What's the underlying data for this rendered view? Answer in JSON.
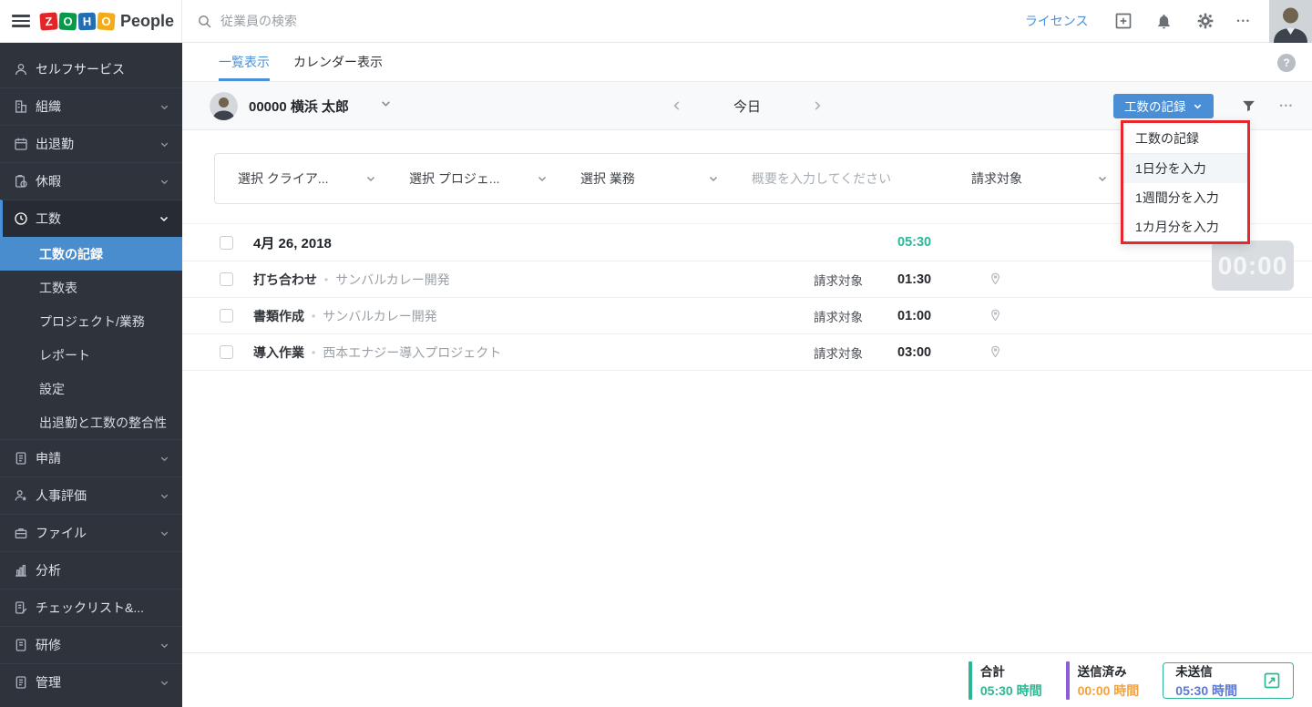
{
  "colors": {
    "accent_blue": "#4a90d9",
    "sidebar_bg": "#2e333c",
    "active_subitem_bg": "#4a8dce",
    "total_green": "#26b99a",
    "submitted_purple": "#8e5bd9",
    "submitted_orange": "#f0a340",
    "unsubmitted_blue": "#5b79d4",
    "annotation_red": "#e8272c"
  },
  "icons": {
    "ellipsis": "•••"
  },
  "header": {
    "logo_letters": [
      "Z",
      "O",
      "H",
      "O"
    ],
    "product": "People",
    "search_placeholder": "従業員の検索",
    "license": "ライセンス"
  },
  "tabs": {
    "list_view": "一覧表示",
    "calendar_view": "カレンダー表示",
    "help": "?"
  },
  "sidebar": {
    "items": [
      {
        "label": "セルフサービス",
        "icon": "user",
        "chevron": false
      },
      {
        "label": "組織",
        "icon": "building",
        "chevron": true
      },
      {
        "label": "出退勤",
        "icon": "calendar",
        "chevron": true
      },
      {
        "label": "休暇",
        "icon": "leave-clipboard",
        "chevron": true
      },
      {
        "label": "工数",
        "icon": "clock",
        "chevron": true,
        "expanded": true,
        "active": true
      },
      {
        "label": "申請",
        "icon": "form",
        "chevron": true
      },
      {
        "label": "人事評価",
        "icon": "appraisal",
        "chevron": true
      },
      {
        "label": "ファイル",
        "icon": "files",
        "chevron": true
      },
      {
        "label": "分析",
        "icon": "analytics",
        "chevron": false
      },
      {
        "label": "チェックリスト&...",
        "icon": "checklist",
        "chevron": false
      },
      {
        "label": "研修",
        "icon": "training",
        "chevron": true
      },
      {
        "label": "管理",
        "icon": "admin",
        "chevron": true
      }
    ],
    "timesheet_subitems": [
      {
        "label": "工数の記録",
        "active": true
      },
      {
        "label": "工数表",
        "active": false
      },
      {
        "label": "プロジェクト/業務",
        "active": false
      },
      {
        "label": "レポート",
        "active": false
      },
      {
        "label": "設定",
        "active": false
      },
      {
        "label": "出退勤と工数の整合性",
        "active": false
      }
    ]
  },
  "context_bar": {
    "employee": "00000 横浜 太郎",
    "today": "今日",
    "record_button": "工数の記録"
  },
  "dropdown_menu": {
    "items": [
      "工数の記録",
      "1日分を入力",
      "1週間分を入力",
      "1カ月分を入力"
    ],
    "highlighted_index": 1
  },
  "filter_bar": {
    "client_select": "選択 クライア...",
    "project_select": "選択 プロジェ...",
    "job_select": "選択 業務",
    "summary_placeholder": "概要を入力してください",
    "billable_select": "請求対象",
    "timer": "00:00"
  },
  "timesheet": {
    "separator": "•",
    "date_header": {
      "date": "4月 26, 2018",
      "total": "05:30"
    },
    "rows": [
      {
        "task": "打ち合わせ",
        "project": "サンバルカレー開発",
        "billable": "請求対象",
        "hours": "01:30"
      },
      {
        "task": "書類作成",
        "project": "サンバルカレー開発",
        "billable": "請求対象",
        "hours": "01:00"
      },
      {
        "task": "導入作業",
        "project": "西本エナジー導入プロジェクト",
        "billable": "請求対象",
        "hours": "03:00"
      }
    ]
  },
  "footer": {
    "total": {
      "label": "合計",
      "value": "05:30 時間"
    },
    "submitted": {
      "label": "送信済み",
      "value": "00:00 時間"
    },
    "unsubmitted": {
      "label": "未送信",
      "value": "05:30 時間"
    }
  }
}
